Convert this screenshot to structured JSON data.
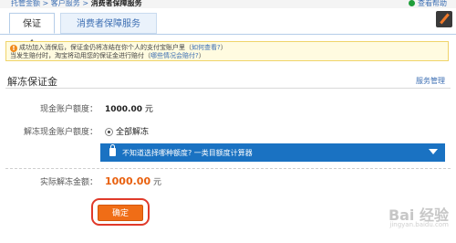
{
  "breadcrumb": {
    "items": [
      "托管金额",
      "客户服务"
    ],
    "current": "消费者保障服务",
    "separator": " > "
  },
  "header": {
    "view_help": "查看帮助"
  },
  "tabs": [
    {
      "label": "保证金",
      "active": true
    },
    {
      "label": "消费者保障服务",
      "active": false
    }
  ],
  "notice": {
    "line1_text": "成功加入消保后，保证金仍将冻结在你个人的支付宝账户里（",
    "line1_link": "如何查看?",
    "line1_end": "）",
    "line2_text": "当发生赔付时，淘宝将动用您的保证金进行赔付（",
    "line2_link": "哪些情况会赔付?",
    "line2_end": "）"
  },
  "section": {
    "title": "解冻保证金",
    "service_manage": "服务管理"
  },
  "form": {
    "balance_label": "现金账户额度：",
    "balance_value": "1000.00",
    "balance_unit": "元",
    "unfreeze_label": "解冻现金账户额度：",
    "unfreeze_option": "全部解冻",
    "info_bar_text": "不知道选择哪种额度? 一类目额度计算器",
    "actual_label": "实际解冻金额：",
    "actual_value": "1000.00",
    "actual_unit": "元"
  },
  "actions": {
    "confirm": "确定"
  },
  "watermark": {
    "text": "Bai 经验",
    "sub": "jingyan.baidu.com"
  },
  "colors": {
    "accent_blue": "#1a72c2",
    "link_blue": "#3d6fb3",
    "amount_orange": "#e8600e",
    "button_orange": "#f06d16",
    "highlight_red": "#e03a2a"
  }
}
